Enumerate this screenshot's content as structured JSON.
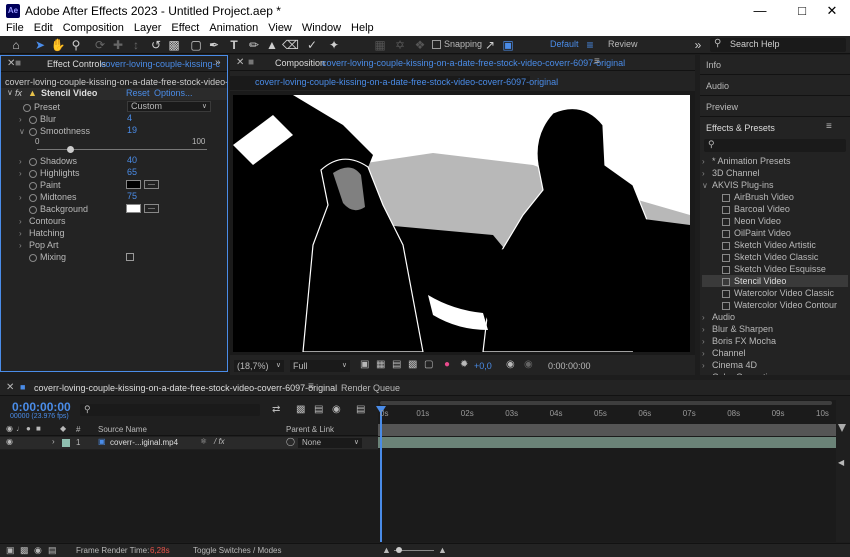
{
  "app": {
    "title": "Adobe After Effects 2023 - Untitled Project.aep *",
    "logo_text": "Ae"
  },
  "menu": [
    "File",
    "Edit",
    "Composition",
    "Layer",
    "Effect",
    "Animation",
    "View",
    "Window",
    "Help"
  ],
  "toolbar": {
    "snapping_label": "Snapping",
    "workspace_default": "Default",
    "workspace_review": "Review",
    "search_placeholder": "Search Help"
  },
  "effect_controls": {
    "tab_label": "Effect Controls",
    "tab_comp": "coverr-loving-couple-kissing-c",
    "layer_path": "coverr-loving-couple-kissing-on-a-date-free-stock-video-coverr-60",
    "effect_name": "Stencil Video",
    "reset": "Reset",
    "options": "Options...",
    "preset_label": "Preset",
    "preset_value": "Custom",
    "blur_label": "Blur",
    "blur_value": "4",
    "smoothness_label": "Smoothness",
    "smoothness_value": "19",
    "slider_min": "0",
    "slider_max": "100",
    "shadows_label": "Shadows",
    "shadows_value": "40",
    "highlights_label": "Highlights",
    "highlights_value": "65",
    "paint_label": "Paint",
    "midtones_label": "Midtones",
    "midtones_value": "75",
    "background_label": "Background",
    "contours": "Contours",
    "hatching": "Hatching",
    "popart": "Pop Art",
    "mixing": "Mixing"
  },
  "composition": {
    "tab_label": "Composition",
    "comp_name": "coverr-loving-couple-kissing-on-a-date-free-stock-video-coverr-6097-original",
    "sub_tab": "coverr-loving-couple-kissing-on-a-date-free-stock-video-coverr-6097-original",
    "zoom": "(18,7%)",
    "resolution": "Full",
    "exposure": "+0,0",
    "timecode": "0:00:00:00"
  },
  "right_panel": {
    "info": "Info",
    "audio": "Audio",
    "preview": "Preview",
    "effects_presets": "Effects & Presets",
    "tree": [
      {
        "label": "* Animation Presets",
        "level": 0,
        "open": false
      },
      {
        "label": "3D Channel",
        "level": 0,
        "open": false
      },
      {
        "label": "AKVIS Plug-ins",
        "level": 0,
        "open": true
      },
      {
        "label": "AirBrush Video",
        "level": 1
      },
      {
        "label": "Barcoal Video",
        "level": 1
      },
      {
        "label": "Neon Video",
        "level": 1
      },
      {
        "label": "OilPaint Video",
        "level": 1
      },
      {
        "label": "Sketch Video Artistic",
        "level": 1
      },
      {
        "label": "Sketch Video Classic",
        "level": 1
      },
      {
        "label": "Sketch Video Esquisse",
        "level": 1
      },
      {
        "label": "Stencil Video",
        "level": 1,
        "selected": true
      },
      {
        "label": "Watercolor Video Classic",
        "level": 1
      },
      {
        "label": "Watercolor Video Contour",
        "level": 1
      },
      {
        "label": "Audio",
        "level": 0,
        "open": false
      },
      {
        "label": "Blur & Sharpen",
        "level": 0,
        "open": false
      },
      {
        "label": "Boris FX Mocha",
        "level": 0,
        "open": false
      },
      {
        "label": "Channel",
        "level": 0,
        "open": false
      },
      {
        "label": "Cinema 4D",
        "level": 0,
        "open": false
      },
      {
        "label": "Color Correction",
        "level": 0,
        "open": false
      }
    ]
  },
  "timeline": {
    "tab_label": "coverr-loving-couple-kissing-on-a-date-free-stock-video-coverr-6097-original",
    "render_queue": "Render Queue",
    "timecode": "0:00:00:00",
    "fps": "00000 (23.976 fps)",
    "col_hash": "#",
    "col_source": "Source Name",
    "col_parent": "Parent & Link",
    "layer_index": "1",
    "layer_name": "coverr-...iginal.mp4",
    "layer_parent": "None",
    "ruler": [
      "0s",
      "01s",
      "02s",
      "03s",
      "04s",
      "05s",
      "06s",
      "07s",
      "08s",
      "09s",
      "10s"
    ]
  },
  "statusbar": {
    "frame_render_label": "Frame Render Time:",
    "frame_render_value": "6,28s",
    "toggle": "Toggle Switches / Modes"
  },
  "colors": {
    "accent": "#4a8ce8",
    "selected_bg": "#3a3a3a",
    "layer_bar": "#6b8378",
    "render_time": "#e8534a"
  }
}
